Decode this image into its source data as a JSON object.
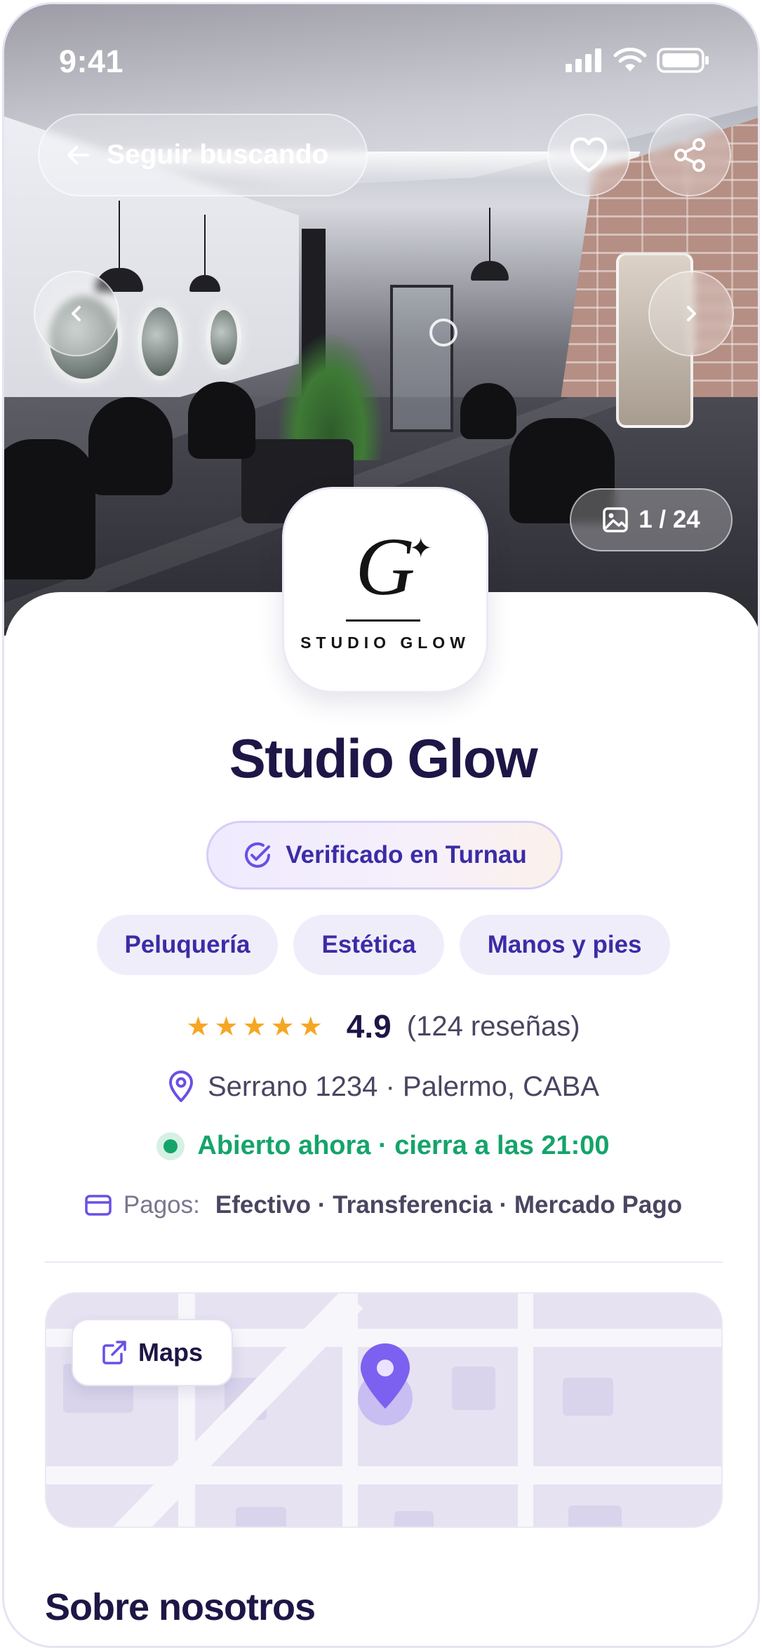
{
  "status_bar": {
    "time": "9:41"
  },
  "header": {
    "back_label": "Seguir buscando",
    "favorite_icon": "heart-icon",
    "share_icon": "share-icon"
  },
  "gallery": {
    "counter": "1 / 24",
    "current": 1,
    "total": 24
  },
  "business": {
    "logo_letter": "G",
    "logo_text": "STUDIO GLOW",
    "name": "Studio Glow",
    "verified_label": "Verificado en Turnau",
    "categories": [
      "Peluquería",
      "Estética",
      "Manos y pies"
    ],
    "rating_stars": "★★★★★",
    "rating_value": "4.9",
    "rating_count": "(124 reseñas)",
    "address": "Serrano 1234 · Palermo, CABA",
    "open_status": "Abierto ahora · cierra a las 21:00",
    "payments_label": "Pagos:",
    "payments_value": "Efectivo · Transferencia · Mercado Pago"
  },
  "map": {
    "button_label": "Maps"
  },
  "sections": {
    "about_title": "Sobre nosotros"
  },
  "colors": {
    "brand": "#3b2ca6",
    "accent": "#7c60f0",
    "open_green": "#14a46a",
    "star": "#f5a623",
    "title": "#1e1646"
  }
}
